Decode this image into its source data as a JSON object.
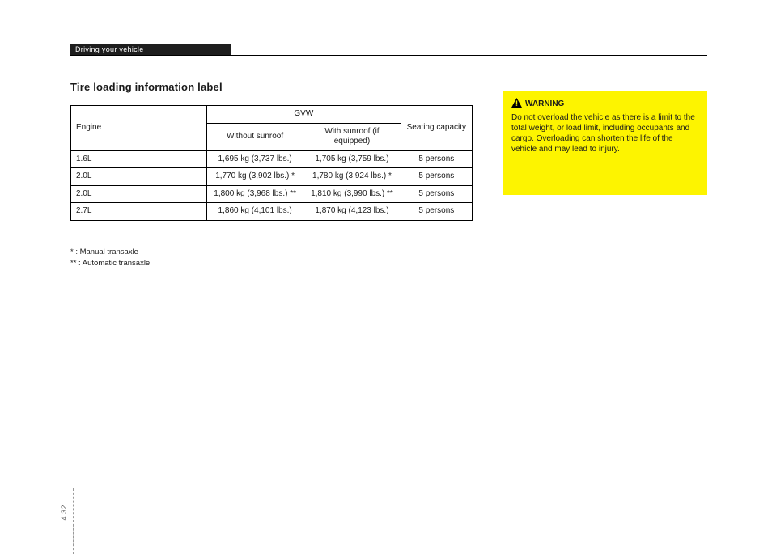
{
  "header": {
    "tab_label": "Driving your vehicle",
    "section_title": "Tire loading information label"
  },
  "table": {
    "c0_label": "Engine",
    "group1_label": "GVW",
    "c1_label": "Without sunroof",
    "c2_label": "With sunroof (if equipped)",
    "group2_label": "Seating capacity",
    "rows": [
      {
        "engine": "1.6L",
        "without": "1,695 kg (3,737 lbs.)",
        "with": "1,705 kg (3,759 lbs.)",
        "seats": "5 persons"
      },
      {
        "engine": "2.0L",
        "without": "1,770 kg (3,902 lbs.) *",
        "with": "1,780 kg (3,924 lbs.) *",
        "seats": "5 persons"
      },
      {
        "engine": "2.0L",
        "without": "1,800 kg (3,968 lbs.) **",
        "with": "1,810 kg (3,990 lbs.) **",
        "seats": "5 persons"
      },
      {
        "engine": "2.7L",
        "without": "1,860 kg (4,101 lbs.)",
        "with": "1,870 kg (4,123 lbs.)",
        "seats": "5 persons"
      }
    ]
  },
  "table_footnotes": {
    "f1": "* : Manual transaxle",
    "f2": "** : Automatic transaxle"
  },
  "warning": {
    "head": "WARNING",
    "body": "Do not overload the vehicle as there is a limit to the total weight, or load limit, including occupants and cargo. Overloading can shorten the life of the vehicle and may lead to injury."
  },
  "footer": {
    "page_ref": "4  32"
  }
}
